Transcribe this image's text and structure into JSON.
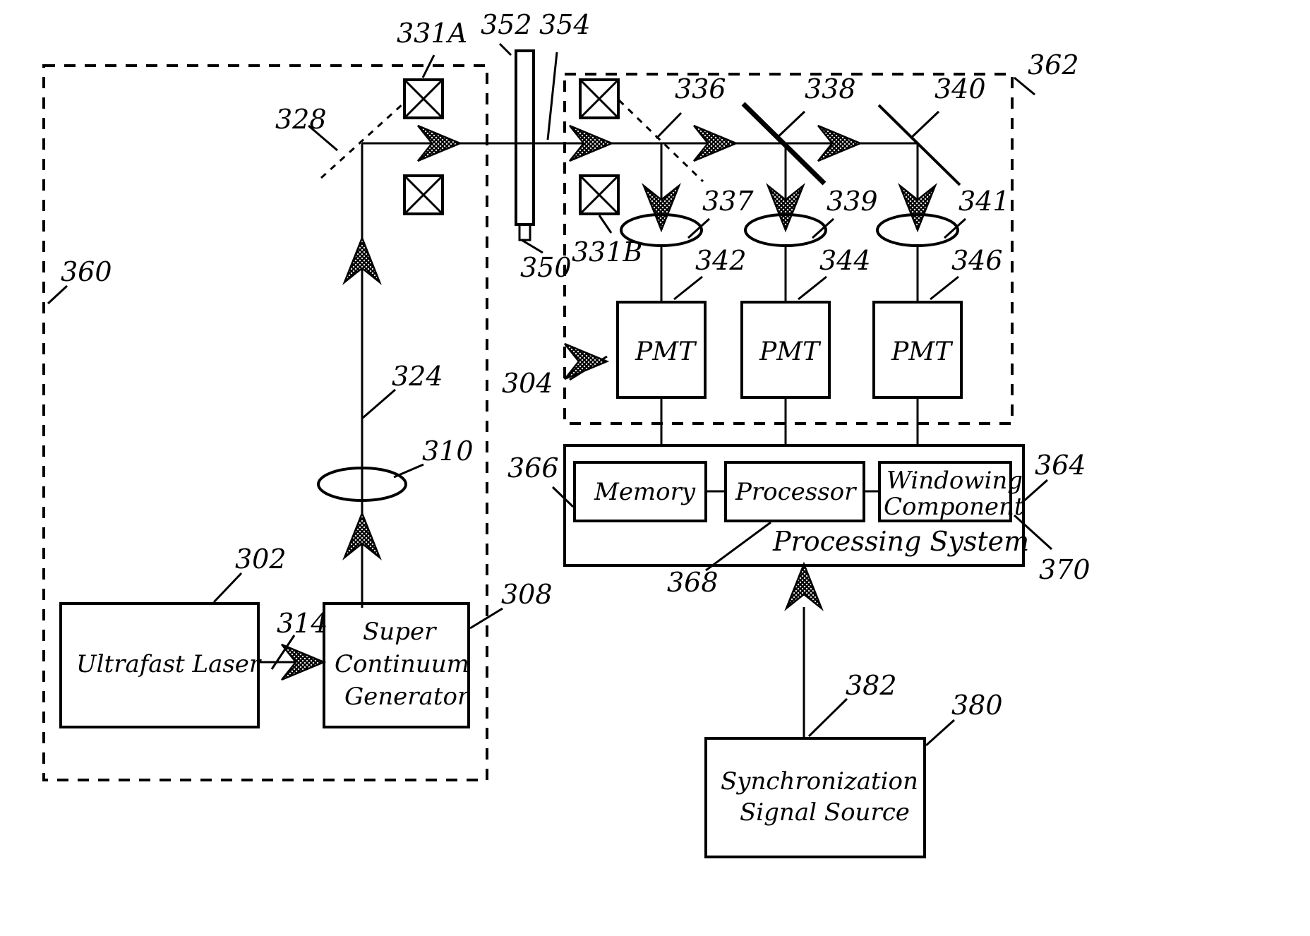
{
  "figure": {
    "title": "Optical pump-probe spectroscopy system block diagram",
    "type": "patent-figure"
  },
  "boxes": {
    "ultrafast_laser": "Ultrafast Laser",
    "super_continuum_l1": "Super",
    "super_continuum_l2": "Continuum",
    "super_continuum_l3": "Generator",
    "pmt1": "PMT",
    "pmt2": "PMT",
    "pmt3": "PMT",
    "memory": "Memory",
    "processor": "Processor",
    "windowing_l1": "Windowing",
    "windowing_l2": "Component",
    "processing_system": "Processing System",
    "sync_l1": "Synchronization",
    "sync_l2": "Signal Source"
  },
  "reference_numerals": {
    "n302": "302",
    "n304": "304",
    "n308": "308",
    "n310": "310",
    "n314": "314",
    "n324": "324",
    "n328": "328",
    "n331A": "331A",
    "n331B": "331B",
    "n336": "336",
    "n337": "337",
    "n338": "338",
    "n339": "339",
    "n340": "340",
    "n341": "341",
    "n342": "342",
    "n344": "344",
    "n346": "346",
    "n350": "350",
    "n352": "352",
    "n354": "354",
    "n360": "360",
    "n362": "362",
    "n364": "364",
    "n366": "366",
    "n368": "368",
    "n370": "370",
    "n380": "380",
    "n382": "382"
  },
  "elements": {
    "filter_331A": "crossed-square-filter",
    "filter_331B": "crossed-square-filter",
    "mirror_328": "turning-mirror",
    "beamsplitter_336": "dichroic-beamsplitter",
    "beamsplitter_338": "dichroic-beamsplitter",
    "beamsplitter_340": "dichroic-beamsplitter",
    "lens_310": "collimating-lens",
    "lens_337": "focusing-lens",
    "lens_339": "focusing-lens",
    "lens_341": "focusing-lens",
    "sample_352": "sample-cuvette",
    "enclosure_360": "source-enclosure-dashed",
    "enclosure_362": "detection-enclosure-dashed"
  },
  "colors": {
    "line": "#000000",
    "background": "#ffffff"
  }
}
